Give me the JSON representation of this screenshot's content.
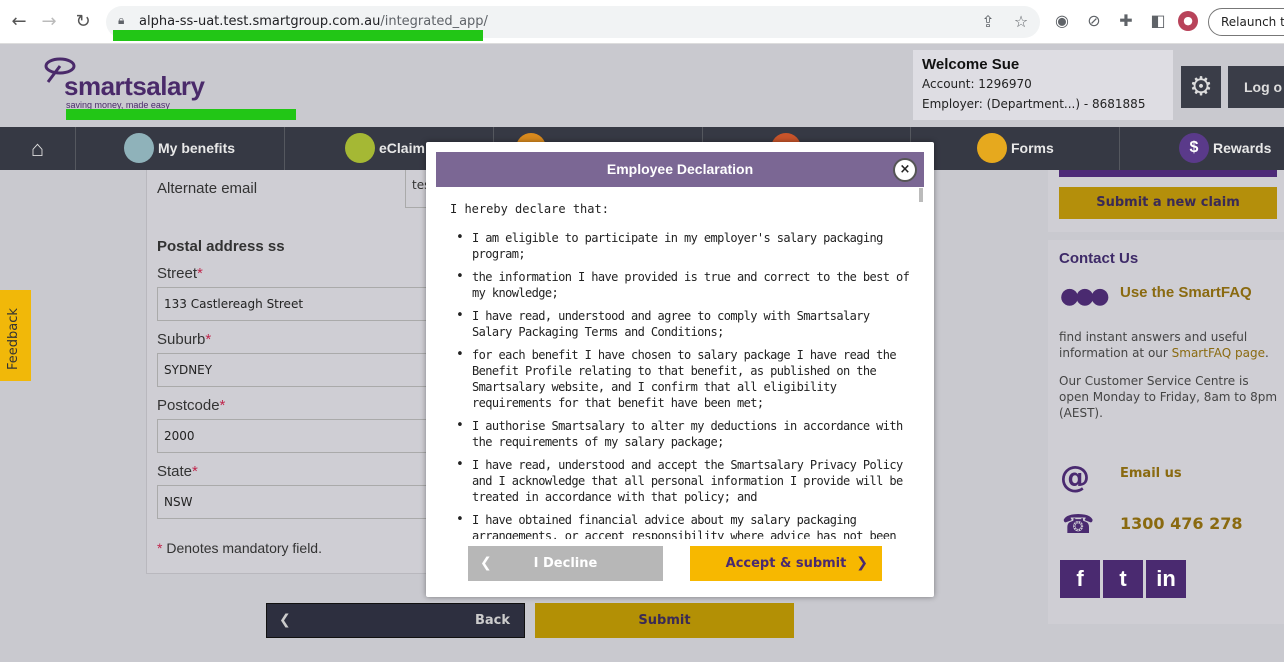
{
  "browser": {
    "url_host": "alpha-ss-uat.test.smartgroup.com.au",
    "url_path": "/integrated_app/",
    "relaunch_label": "Relaunch to"
  },
  "header": {
    "logo_text": "smartsalary",
    "logo_tagline": "saving money, made easy",
    "welcome_title": "Welcome Sue",
    "account": "Account: 1296970",
    "employer": "Employer: (Department...) - 8681885",
    "logout_label": "Log o"
  },
  "nav": {
    "items": [
      {
        "label": ""
      },
      {
        "label": "My benefits"
      },
      {
        "label": "eClaim"
      },
      {
        "label": ""
      },
      {
        "label": ""
      },
      {
        "label": "Forms"
      },
      {
        "label": "Rewards"
      }
    ]
  },
  "form": {
    "alt_email_label": "Alternate email",
    "alt_email_value": "tes",
    "postal_heading": "Postal address ss",
    "street_label": "Street",
    "street_value": "133 Castlereagh Street",
    "suburb_label": "Suburb",
    "suburb_value": "SYDNEY",
    "postcode_label": "Postcode",
    "postcode_value": "2000",
    "state_label": "State",
    "state_value": "NSW",
    "required_marker": "*",
    "mandatory_note": "Denotes mandatory field.",
    "back_label": "Back",
    "submit_label": "Submit"
  },
  "sidebar": {
    "new_claim_label": "Submit a new claim",
    "contact_title": "Contact Us",
    "faq_link": "Use the SmartFAQ",
    "faq_text_pre": "find instant answers and useful information at our ",
    "faq_text_link": "SmartFAQ page",
    "faq_text_post": ".",
    "hours_text": "Our Customer Service Centre is open Monday to Friday, 8am to 8pm (AEST).",
    "email_label": "Email us",
    "phone": "1300 476 278",
    "social": [
      "f",
      "t",
      "in"
    ]
  },
  "feedback_label": "Feedback",
  "modal": {
    "title": "Employee Declaration",
    "close_symbol": "×",
    "intro": "I hereby declare that:",
    "items": [
      "I am eligible to participate in my employer's salary packaging program;",
      "the information I have provided is true and correct to the best of my knowledge;",
      "I have read, understood and agree to comply with Smartsalary Salary Packaging Terms and Conditions;",
      "for each benefit I have chosen to salary package I have read the Benefit Profile relating to that benefit, as published on the Smartsalary website, and I confirm that all eligibility requirements for that benefit have been met;",
      "I authorise Smartsalary to alter my deductions in accordance with the requirements of my salary package;",
      "I have read, understood and accept the Smartsalary Privacy Policy and I acknowledge that all personal information I provide will be treated in accordance with that policy; and",
      "I have obtained financial advice about my salary packaging arrangements, or accept responsibility where advice has not been sought:"
    ],
    "decline_label": "I Decline",
    "accept_label": "Accept & submit"
  },
  "colors": {
    "brand_purple": "#4a2a70",
    "accent_gold": "#f7b800",
    "nav_dark": "#363944",
    "modal_header": "#7b6794"
  }
}
